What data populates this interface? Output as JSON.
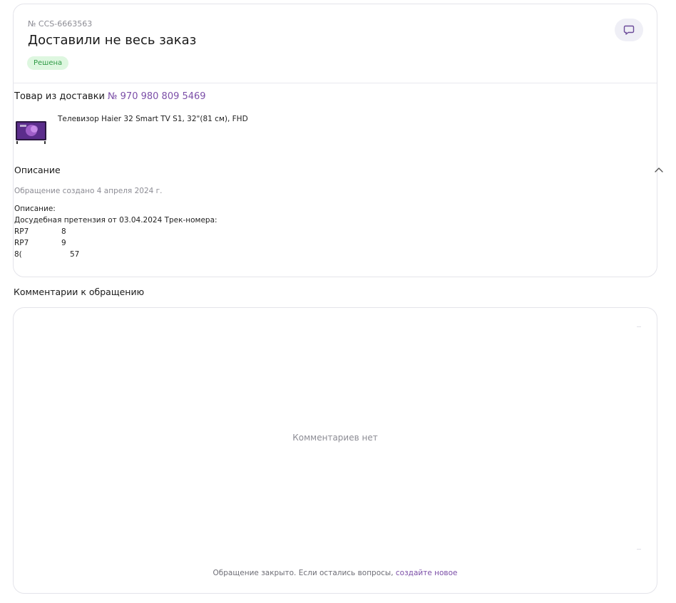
{
  "ticket": {
    "number": "№ CCS-6663563",
    "title": "Доставили не весь заказ",
    "status": "Решена"
  },
  "delivery": {
    "label": "Товар из доставки",
    "number": "№ 970 980 809 5469",
    "product_name": "Телевизор Haier 32 Smart TV S1, 32\"(81 см), FHD"
  },
  "description": {
    "title": "Описание",
    "created": "Обращение создано 4 апреля 2024 г.",
    "lines": [
      "Описание:",
      "Досудебная претензия от 03.04.2024 Трек-номера:"
    ],
    "tracks": [
      {
        "a": "RP7",
        "b": "8"
      },
      {
        "a": "RP7",
        "b": "9"
      },
      {
        "a": "8(",
        "b": "57"
      }
    ]
  },
  "comments": {
    "heading": "Комментарии к обращению",
    "empty_text": "Комментариев нет",
    "closed_text": "Обращение закрыто. Если остались вопросы,",
    "create_link": "создайте новое"
  },
  "colors": {
    "accent": "#7c4fa8",
    "status_bg": "#def7e0",
    "status_text": "#2e9a44"
  },
  "icons": {
    "chat": "chat-bubble-icon",
    "chevron": "chevron-up-icon"
  }
}
